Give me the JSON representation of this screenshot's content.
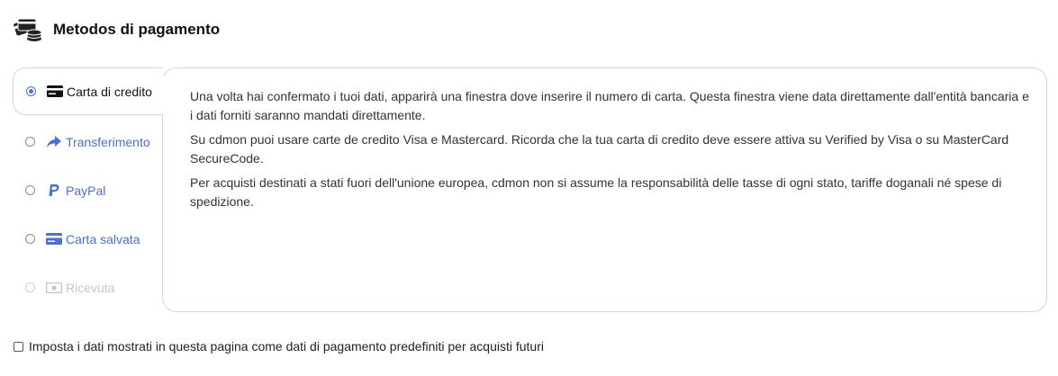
{
  "header": {
    "title": "Metodos di pagamento",
    "icon": "cards-coins-icon"
  },
  "methods": [
    {
      "label": "Carta di credito",
      "icon": "credit-card-icon",
      "selected": true,
      "disabled": false
    },
    {
      "label": "Transferimento",
      "icon": "share-arrow-icon",
      "selected": false,
      "disabled": false
    },
    {
      "label": "PayPal",
      "icon": "paypal-icon",
      "selected": false,
      "disabled": false
    },
    {
      "label": "Carta salvata",
      "icon": "credit-card-icon",
      "selected": false,
      "disabled": false
    },
    {
      "label": "Ricevuta",
      "icon": "money-bill-icon",
      "selected": false,
      "disabled": true
    }
  ],
  "content": {
    "p1": "Una volta hai confermato i tuoi dati, apparirà una finestra dove inserire il numero di carta. Questa finestra viene data direttamente dall'entità bancaria e i dati forniti saranno mandati direttamente.",
    "p2": "Su cdmon puoi usare carte de credito Visa e Mastercard. Ricorda che la tua carta di credito deve essere attiva su Verified by Visa o su MasterCard SecureCode.",
    "p3": "Per acquisti destinati a stati fuori dell'unione europea, cdmon non si assume la responsabilità delle tasse di ogni stato, tariffe doganali né spese di spedizione."
  },
  "footer": {
    "checkbox_label": "Imposta i dati mostrati in questa pagina come dati di pagamento predefiniti per acquisti futuri",
    "checked": false
  },
  "colors": {
    "accent": "#4a6fd8",
    "border": "#c9d6f2",
    "disabled": "#c6c6c6"
  }
}
